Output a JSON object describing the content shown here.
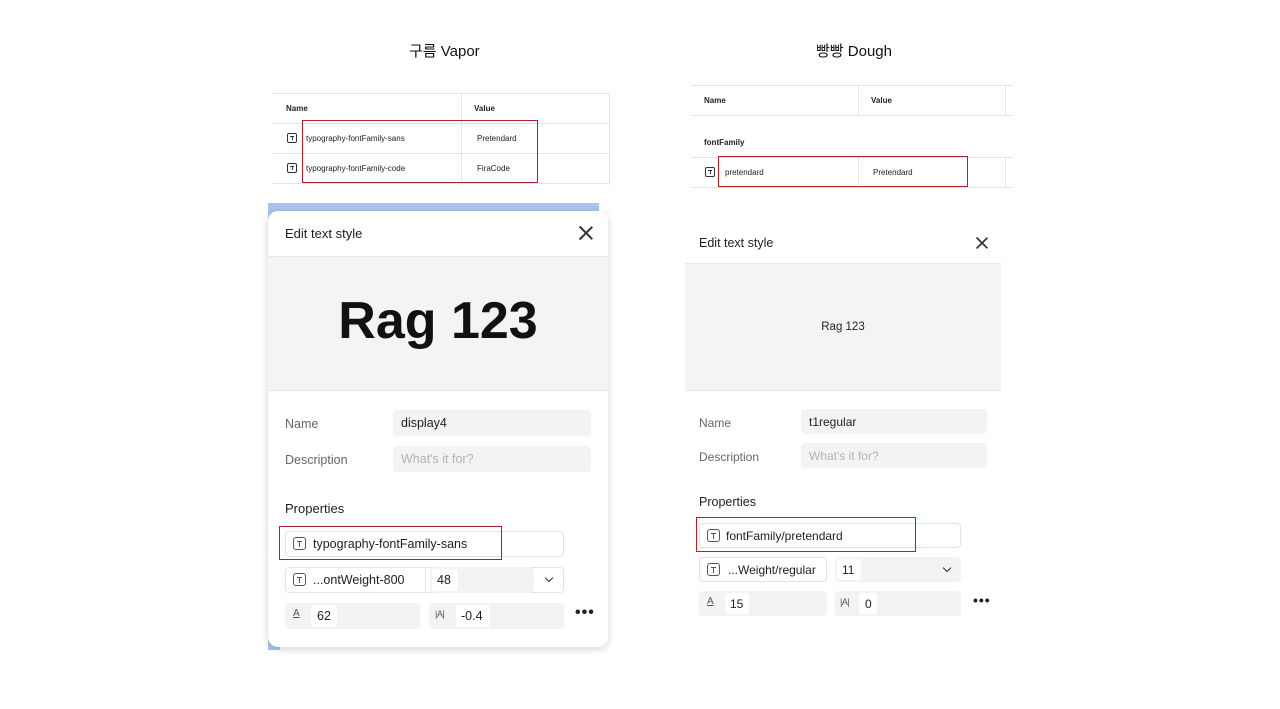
{
  "columns": {
    "vapor": {
      "title": "구름 Vapor"
    },
    "dough": {
      "title": "빵빵 Dough"
    }
  },
  "vapor_table": {
    "headers": {
      "name": "Name",
      "value": "Value"
    },
    "rows": [
      {
        "name": "typography-fontFamily-sans",
        "value": "Pretendard"
      },
      {
        "name": "typography-fontFamily-code",
        "value": "FiraCode"
      }
    ]
  },
  "dough_table": {
    "headers": {
      "name": "Name",
      "value": "Value"
    },
    "group": "fontFamily",
    "rows": [
      {
        "name": "pretendard",
        "value": "Pretendard"
      }
    ]
  },
  "vapor_panel": {
    "title": "Edit text style",
    "preview_text": "Rag 123",
    "name_label": "Name",
    "name_value": "display4",
    "description_label": "Description",
    "description_placeholder": "What's it for?",
    "properties_label": "Properties",
    "font_family": "typography-fontFamily-sans",
    "font_weight": "...ontWeight-800",
    "font_size": "48",
    "line_height": "62",
    "letter_spacing": "-0.4",
    "more": "•••"
  },
  "dough_panel": {
    "title": "Edit text style",
    "preview_text": "Rag 123",
    "name_label": "Name",
    "name_value": "t1regular",
    "description_label": "Description",
    "description_placeholder": "What's it for?",
    "properties_label": "Properties",
    "font_family": "fontFamily/pretendard",
    "font_weight": "...Weight/regular",
    "font_size": "11",
    "line_height": "15",
    "letter_spacing": "0",
    "more": "•••"
  },
  "colors": {
    "highlight_red": "#b0202a",
    "selection_blue": "#a9c4ec",
    "preview_bg": "#f4f4f4",
    "field_bg": "#f3f3f3"
  },
  "icons": {
    "close": "close-icon",
    "text_token": "text-style-icon",
    "chevron": "chevron-down-icon",
    "line_height": "line-height-icon",
    "letter_spacing": "letter-spacing-icon",
    "more": "more-options-icon"
  }
}
